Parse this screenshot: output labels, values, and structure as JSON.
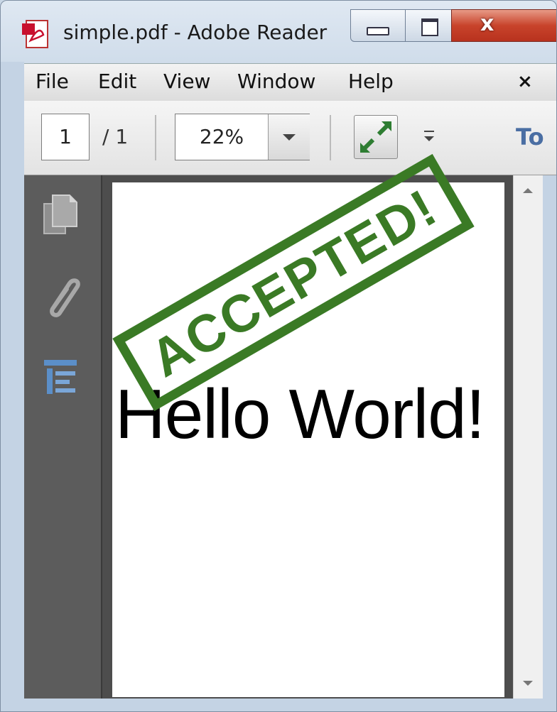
{
  "window": {
    "title": "simple.pdf - Adobe Reader",
    "close_glyph": "x"
  },
  "menu": {
    "items": [
      "File",
      "Edit",
      "View",
      "Window",
      "Help"
    ],
    "close_glyph": "×"
  },
  "toolbar": {
    "page_current": "1",
    "page_total": "/ 1",
    "zoom": "22%",
    "tools_label": "To",
    "icons": [
      "fit-page-icon",
      "more-tools-icon"
    ]
  },
  "sidepanel": {
    "icons": [
      "pages-icon",
      "attachments-icon",
      "bookmarks-icon"
    ]
  },
  "document": {
    "text": "Hello World!",
    "stamp": "ACCEPTED!"
  },
  "colors": {
    "stamp": "#3a7a25",
    "close_button": "#c8432b",
    "tools_text": "#4a6ea3",
    "bookmark_icon": "#5b8fc9"
  }
}
